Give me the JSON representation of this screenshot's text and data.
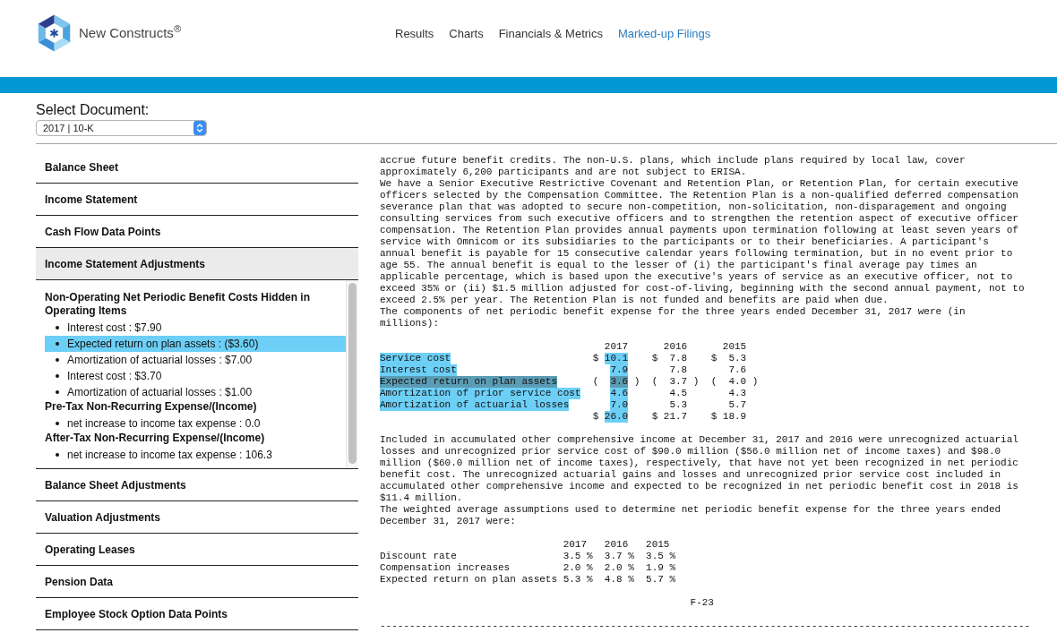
{
  "header": {
    "brand": "New Constructs$^{®}$",
    "nav": [
      {
        "label": "Results",
        "selected": false
      },
      {
        "label": "Charts",
        "selected": false
      },
      {
        "label": "Financials & Metrics",
        "selected": false
      },
      {
        "label": "Marked-up Filings",
        "selected": true
      }
    ]
  },
  "document_picker": {
    "label": "Select Document:",
    "select": {
      "value": "2017 | 10-K"
    }
  },
  "sidebar": {
    "sections": [
      {
        "label": "Balance Sheet",
        "expanded": false
      },
      {
        "label": "Income Statement",
        "expanded": false
      },
      {
        "label": "Cash Flow Data Points",
        "expanded": false
      },
      {
        "label": "Income Statement Adjustments",
        "expanded": true,
        "groups": [
          {
            "title": "Non-Operating Net Periodic Benefit Costs Hidden in Operating Items",
            "items": [
              {
                "text": "Interest cost : $7.90",
                "selected": false
              },
              {
                "text": "Expected return on plan assets : ($3.60)",
                "selected": true
              },
              {
                "text": "Amortization of actuarial losses : $7.00",
                "selected": false
              },
              {
                "text": "Interest cost : $3.70",
                "selected": false
              },
              {
                "text": "Amortization of actuarial losses : $1.00",
                "selected": false
              }
            ]
          },
          {
            "title": "Pre-Tax Non-Recurring Expense/(Income)",
            "items": [
              {
                "text": "net increase to income tax expense : 0.0",
                "selected": false
              }
            ]
          },
          {
            "title": "After-Tax Non-Recurring Expense/(Income)",
            "items": [
              {
                "text": "net increase to income tax expense : 106.3",
                "selected": false
              }
            ]
          }
        ]
      },
      {
        "label": "Balance Sheet Adjustments",
        "expanded": false
      },
      {
        "label": "Valuation Adjustments",
        "expanded": false
      },
      {
        "label": "Operating Leases",
        "expanded": false
      },
      {
        "label": "Pension Data",
        "expanded": false
      },
      {
        "label": "Employee Stock Option Data Points",
        "expanded": false
      }
    ]
  },
  "filing": {
    "blocks": [
      {
        "kind": "paragraph",
        "text": "accrue future benefit credits. The non-U.S. plans, which include plans required by local law, cover\napproximately 6,200 participants and are not subject to ERISA."
      },
      {
        "kind": "paragraph",
        "text": "We have a Senior Executive Restrictive Covenant and Retention Plan, or Retention Plan, for certain executive\nofficers selected by the Compensation Committee. The Retention Plan is a non-qualified deferred compensation\nseverance plan that was adopted to secure non-competition, non-solicitation, non-disparagement and ongoing\nconsulting services from such executive officers and to strengthen the retention aspect of executive officer\ncompensation. The Retention Plan provides annual payments upon termination following at least seven years of\nservice with Omnicom or its subsidiaries to the participants or to their beneficiaries. A participant's\nannual benefit is payable for 15 consecutive calendar years following termination, but in no event prior to\nage 55. The annual benefit is equal to the lesser of (i) the participant's final average pay times an\napplicable percentage, which is based upon the executive's years of service as an executive officer, not to\nexceed 35% or (ii) $1.5 million adjusted for cost-of-living, beginning with the second annual payment, not to\nexceed 2.5% per year. The Retention Plan is not funded and benefits are paid when due."
      },
      {
        "kind": "paragraph",
        "text": "The components of net periodic benefit expense for the three years ended December 31, 2017 were (in\nmillions):"
      },
      {
        "kind": "amount_table",
        "columns": [
          "2017",
          "2016",
          "2015"
        ],
        "rows": [
          {
            "label": "Service cost",
            "highlighted": true,
            "selected": false,
            "cells": [
              {
                "currency": "$",
                "value": "10.1",
                "highlighted": true
              },
              {
                "currency": "$",
                "value": "7.8",
                "highlighted": false
              },
              {
                "currency": "$",
                "value": "5.3",
                "highlighted": false
              }
            ]
          },
          {
            "label": "Interest cost",
            "highlighted": true,
            "selected": false,
            "cells": [
              {
                "value": "7.9",
                "highlighted": true
              },
              {
                "value": "7.8",
                "highlighted": false
              },
              {
                "value": "7.6",
                "highlighted": false
              }
            ]
          },
          {
            "label": "Expected return on plan assets",
            "highlighted": true,
            "selected": true,
            "cells": [
              {
                "open": "(",
                "value": "3.6",
                "close": ")",
                "highlighted": true
              },
              {
                "open": "(",
                "value": "3.7",
                "close": ")",
                "highlighted": false
              },
              {
                "open": "(",
                "value": "4.0",
                "close": ")",
                "highlighted": false
              }
            ]
          },
          {
            "label": "Amortization of prior service cost",
            "highlighted": true,
            "selected": false,
            "cells": [
              {
                "value": "4.6",
                "highlighted": true
              },
              {
                "value": "4.5",
                "highlighted": false
              },
              {
                "value": "4.3",
                "highlighted": false
              }
            ]
          },
          {
            "label": "Amortization of actuarial losses",
            "highlighted": true,
            "selected": false,
            "cells": [
              {
                "value": "7.0",
                "highlighted": true
              },
              {
                "value": "5.3",
                "highlighted": false
              },
              {
                "value": "5.7",
                "highlighted": false
              }
            ]
          },
          {
            "selected": false,
            "cells": [
              {
                "currency": "$",
                "value": "26.0",
                "highlighted": true
              },
              {
                "currency": "$",
                "value": "21.7",
                "highlighted": false
              },
              {
                "currency": "$",
                "value": "18.9",
                "highlighted": false
              }
            ]
          }
        ]
      },
      {
        "kind": "paragraph",
        "text": "Included in accumulated other comprehensive income at December 31, 2017 and 2016 were unrecognized actuarial\nlosses and unrecognized prior service cost of $90.0 million ($56.0 million net of income taxes) and $98.0\nmillion ($60.0 million net of income taxes), respectively, that have not yet been recognized in net periodic\nbenefit cost. The unrecognized actuarial gains and losses and unrecognized prior service cost included in\naccumulated other comprehensive income and expected to be recognized in net periodic benefit cost in 2018 is\n$11.4 million."
      },
      {
        "kind": "paragraph",
        "text": "The weighted average assumptions used to determine net periodic benefit expense for the three years ended\nDecember 31, 2017 were:"
      },
      {
        "kind": "rate_table",
        "columns": [
          "2017",
          "2016",
          "2015"
        ],
        "rows": [
          {
            "label": "Discount rate",
            "values": [
              "3.5 %",
              "3.7 %",
              "3.5 %"
            ]
          },
          {
            "label": "Compensation increases",
            "values": [
              "2.0 %",
              "2.0 %",
              "1.9 %"
            ]
          },
          {
            "label": "Expected return on plan assets",
            "values": [
              "5.3 %",
              "4.8 %",
              "5.7 %"
            ]
          }
        ]
      },
      {
        "kind": "page_number",
        "text": "F-23"
      },
      {
        "kind": "separator",
        "text": "--------------------------------------------------------------------------------------------------------------"
      }
    ]
  }
}
